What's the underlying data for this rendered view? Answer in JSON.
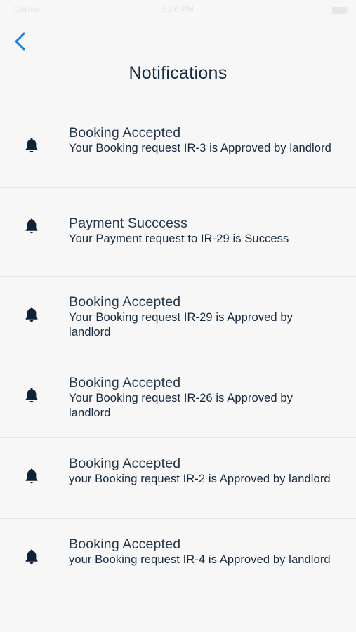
{
  "status_bar": {
    "carrier": "Carrier",
    "time": "5:06 PM"
  },
  "header": {
    "title": "Notifications",
    "back_icon": "chevron-left-icon"
  },
  "colors": {
    "accent": "#1a7fd9",
    "text_dark": "#15293f",
    "background": "#f7f7f7",
    "divider": "#e4e4e4"
  },
  "notifications": [
    {
      "icon": "bell-icon",
      "title": "Booking Accepted",
      "message": "Your  Booking request IR-3  is Approved by landlord"
    },
    {
      "icon": "bell-icon",
      "title": "Payment Succcess",
      "message": "Your  Payment request to  IR-29  is Success"
    },
    {
      "icon": "bell-icon",
      "title": "Booking Accepted",
      "message": "Your  Booking request IR-29  is Approved by landlord"
    },
    {
      "icon": "bell-icon",
      "title": "Booking Accepted",
      "message": "Your  Booking request IR-26  is Approved by landlord"
    },
    {
      "icon": "bell-icon",
      "title": "Booking Accepted",
      "message": "your  Booking request IR-2  is Approved by landlord"
    },
    {
      "icon": "bell-icon",
      "title": "Booking Accepted",
      "message": "your  Booking request IR-4  is Approved by landlord"
    }
  ]
}
